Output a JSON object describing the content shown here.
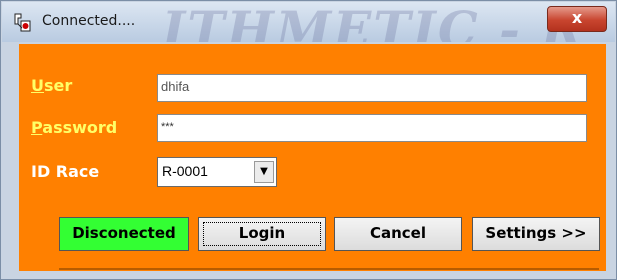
{
  "window": {
    "title": "Connected....",
    "background_watermark": "ITHMETIC - R",
    "close_label": "x"
  },
  "form": {
    "user_label_first": "U",
    "user_label_rest": "ser",
    "user_value": "dhifa",
    "password_label_first": "P",
    "password_label_rest": "assword",
    "password_value": "***",
    "idrace_label": "ID Race",
    "idrace_value": "R-0001"
  },
  "buttons": {
    "status": "Disconected",
    "login": "Login",
    "cancel": "Cancel",
    "settings": "Settings >>"
  },
  "colors": {
    "form_background": "#ff8000",
    "label_yellow": "#ffff66",
    "status_green": "#33ff33"
  }
}
